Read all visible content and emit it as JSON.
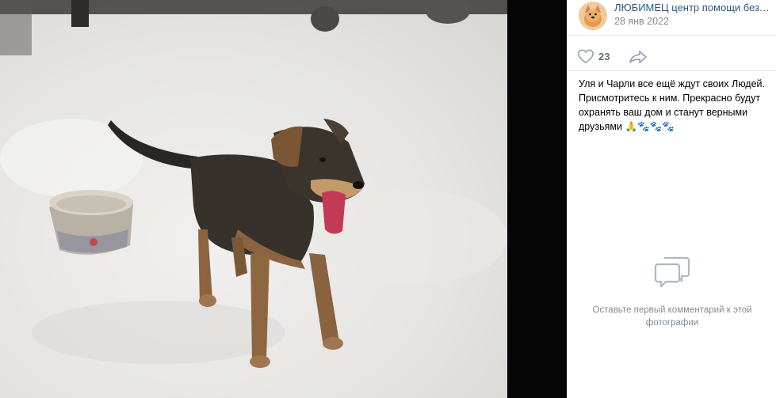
{
  "post": {
    "author": "ЛЮБИМЕЦ центр помощи бездомным животным",
    "date": "28 янв 2022",
    "likes": "23",
    "text_line1": "Уля и Чарли все ещё ждут своих Людей.",
    "text_line2": "Присмотритесь к ним. Прекрасно будут",
    "text_line3": "охранять ваш дом и станут верными",
    "text_line4": "друзьями",
    "text_emoji": "🙏🐾🐾🐾"
  },
  "comments": {
    "empty_text": "Оставьте первый комментарий к этой фотографии"
  },
  "icons": {
    "like": "heart-icon",
    "share": "share-arrow-icon",
    "comments": "comment-bubble-icon"
  },
  "colors": {
    "link": "#2a5885",
    "muted": "#818c99",
    "icon": "#99a2ad",
    "panel_bg": "#ffffff",
    "divider": "#e7e8ec"
  }
}
